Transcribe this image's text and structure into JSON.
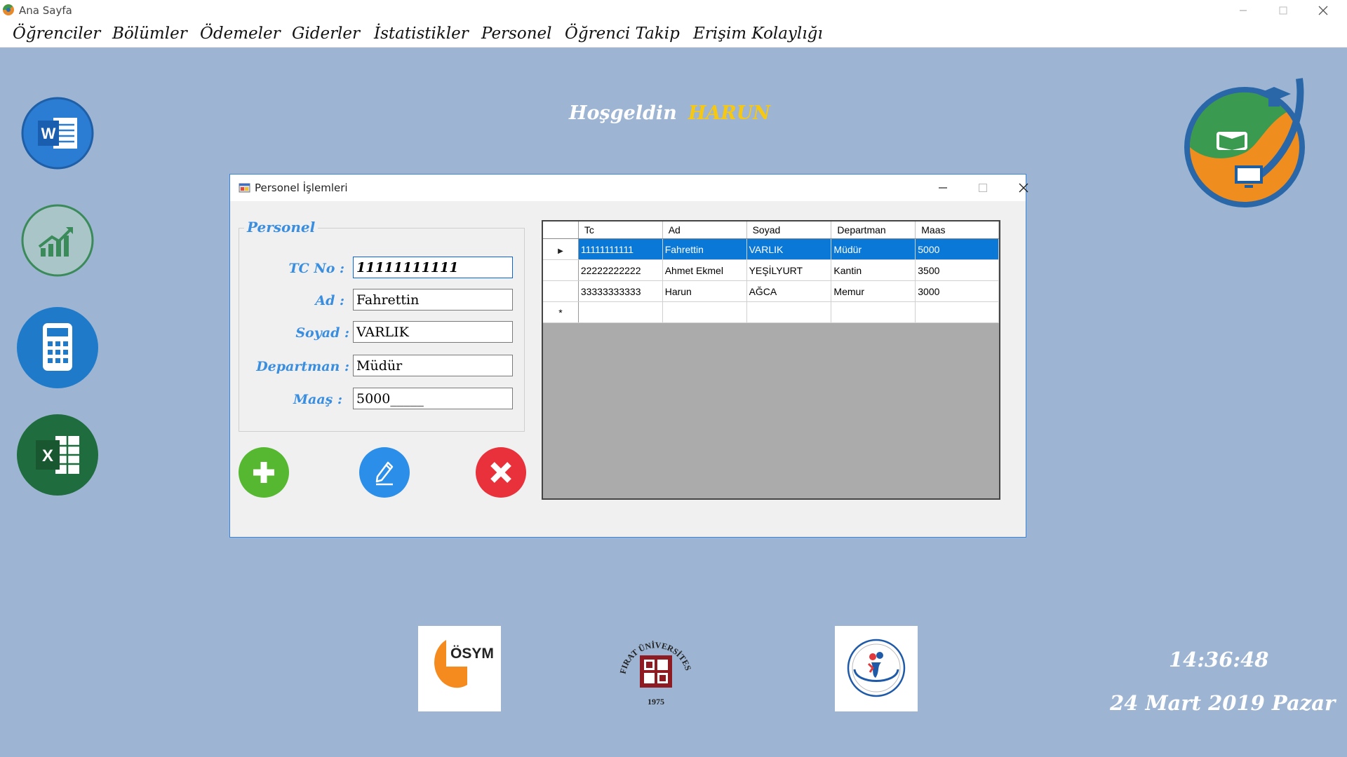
{
  "window": {
    "title": "Ana Sayfa"
  },
  "menu": [
    "Öğrenciler",
    "Bölümler",
    "Ödemeler",
    "Giderler",
    "İstatistikler",
    "Personel",
    "Öğrenci Takip",
    "Erişim Kolaylığı"
  ],
  "welcome": {
    "greeting": "Hoşgeldin",
    "user": "HARUN"
  },
  "sidebar_icons": [
    "word-icon",
    "chart-icon",
    "calculator-icon",
    "excel-icon"
  ],
  "dialog": {
    "title": "Personel İşlemleri",
    "group_title": "Personel",
    "fields": [
      {
        "label": "TC No :",
        "value": "11111111111"
      },
      {
        "label": "Ad :",
        "value": "Fahrettin"
      },
      {
        "label": "Soyad :",
        "value": "VARLIK"
      },
      {
        "label": "Departman :",
        "value": "Müdür"
      },
      {
        "label": "Maaş :",
        "value": "5000_____"
      }
    ],
    "grid": {
      "columns": [
        "Tc",
        "Ad",
        "Soyad",
        "Departman",
        "Maas"
      ],
      "rows": [
        [
          "11111111111",
          "Fahrettin",
          "VARLIK",
          "Müdür",
          "5000"
        ],
        [
          "22222222222",
          "Ahmet Ekmel",
          "YEŞİLYURT",
          "Kantin",
          "3500"
        ],
        [
          "33333333333",
          "Harun",
          "AĞCA",
          "Memur",
          "3000"
        ]
      ],
      "selected_row_marker": "▶",
      "new_row_marker": "*"
    }
  },
  "logos": {
    "osym": "ÖSYM",
    "firat_top": "FIRAT ÜNİVERSİTESİ",
    "firat_year": "1975"
  },
  "status": {
    "time": "14:36:48",
    "date": "24 Mart 2019 Pazar"
  },
  "colors": {
    "background": "#9db5d3",
    "accent": "#3a8ee0",
    "selection": "#0a78d7",
    "username": "#f7c812"
  }
}
